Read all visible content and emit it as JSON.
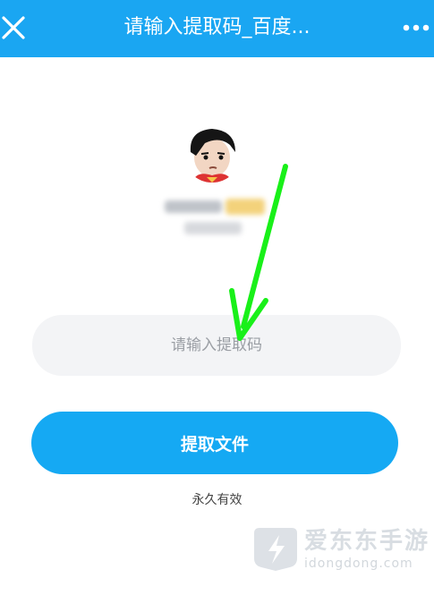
{
  "header": {
    "title": "请输入提取码_百度...",
    "close_icon": "close-icon",
    "more_icon": "more-icon"
  },
  "colors": {
    "header_bg": "#1aa6f2",
    "button_bg": "#15a9f3",
    "input_bg": "#f3f4f6",
    "annotation_arrow": "#19f019"
  },
  "profile": {
    "avatar_icon": "avatar"
  },
  "form": {
    "code_placeholder": "请输入提取码",
    "code_value": "",
    "submit_label": "提取文件",
    "validity_note": "永久有效"
  },
  "watermark": {
    "title": "爱东东手游",
    "url": "idongdong.com"
  }
}
